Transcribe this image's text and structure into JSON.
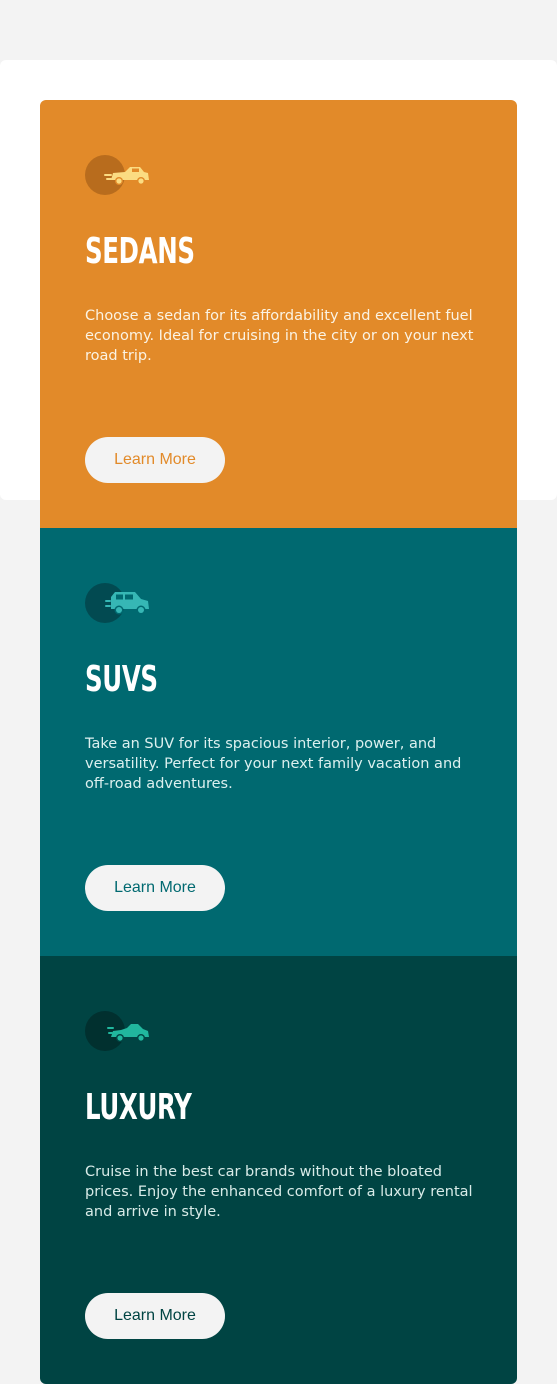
{
  "cards": [
    {
      "key": "sedans",
      "title": "SEDANS",
      "description": "Choose a sedan for its affordability and excellent fuel economy. Ideal for cruising in the city or on your next road trip.",
      "button_label": "Learn More",
      "icon": "sedan-car-icon",
      "colors": {
        "background": "#e28a29",
        "circle": "#b86c1d",
        "icon": "#fbdc82",
        "text": "#fbf3e3",
        "button_text": "#e28a29"
      }
    },
    {
      "key": "suvs",
      "title": "SUVS",
      "description": "Take an SUV for its spacious interior, power, and versatility. Perfect for your next family vacation and off-road adventures.",
      "button_label": "Learn More",
      "icon": "suv-car-icon",
      "colors": {
        "background": "#006970",
        "circle": "#024a51",
        "icon": "#36b7b5",
        "text": "#dcf0ef",
        "button_text": "#006970"
      }
    },
    {
      "key": "luxury",
      "title": "LUXURY",
      "description": "Cruise in the best car brands without the bloated prices. Enjoy the enhanced comfort of a luxury rental and arrive in style.",
      "button_label": "Learn More",
      "icon": "luxury-car-icon",
      "colors": {
        "background": "#004443",
        "circle": "#01302f",
        "icon": "#21b79e",
        "text": "#d8ebe8",
        "button_text": "#004443"
      }
    }
  ]
}
